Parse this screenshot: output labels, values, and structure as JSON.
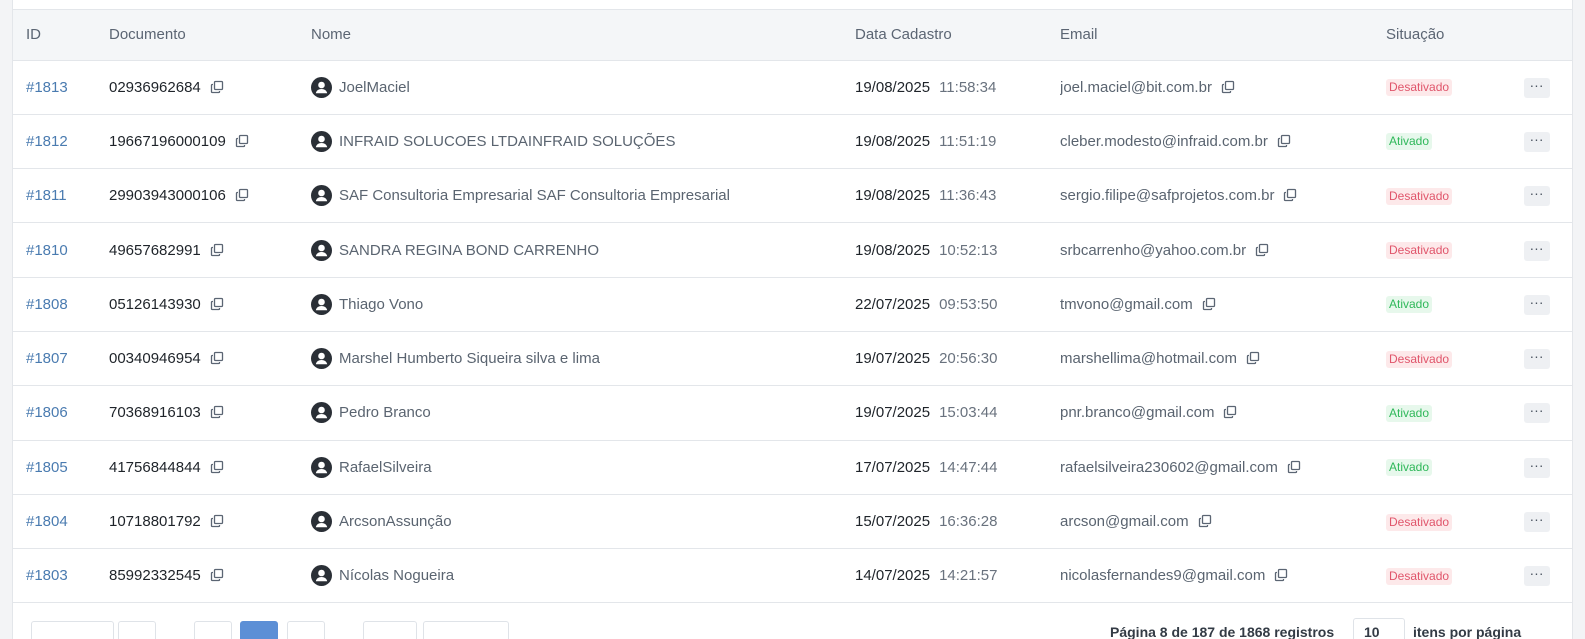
{
  "table": {
    "headers": {
      "id": "ID",
      "documento": "Documento",
      "nome": "Nome",
      "data_cadastro": "Data Cadastro",
      "email": "Email",
      "situacao": "Situação"
    },
    "rows": [
      {
        "id": "#1813",
        "documento": "02936962684",
        "nome": "JoelMaciel",
        "data": "19/08/2025",
        "hora": "11:58:34",
        "email": "joel.maciel@bit.com.br",
        "situacao": "Desativado",
        "status": "off"
      },
      {
        "id": "#1812",
        "documento": "19667196000109",
        "nome": "INFRAID SOLUCOES LTDAINFRAID SOLUÇÕES",
        "data": "19/08/2025",
        "hora": "11:51:19",
        "email": "cleber.modesto@infraid.com.br",
        "situacao": "Ativado",
        "status": "on"
      },
      {
        "id": "#1811",
        "documento": "29903943000106",
        "nome": "SAF Consultoria Empresarial SAF Consultoria Empresarial",
        "data": "19/08/2025",
        "hora": "11:36:43",
        "email": "sergio.filipe@safprojetos.com.br",
        "situacao": "Desativado",
        "status": "off"
      },
      {
        "id": "#1810",
        "documento": "49657682991",
        "nome": "SANDRA REGINA BOND CARRENHO",
        "data": "19/08/2025",
        "hora": "10:52:13",
        "email": "srbcarrenho@yahoo.com.br",
        "situacao": "Desativado",
        "status": "off"
      },
      {
        "id": "#1808",
        "documento": "05126143930",
        "nome": "Thiago Vono",
        "data": "22/07/2025",
        "hora": "09:53:50",
        "email": "tmvono@gmail.com",
        "situacao": "Ativado",
        "status": "on"
      },
      {
        "id": "#1807",
        "documento": "00340946954",
        "nome": "Marshel Humberto Siqueira silva e lima",
        "data": "19/07/2025",
        "hora": "20:56:30",
        "email": "marshellima@hotmail.com",
        "situacao": "Desativado",
        "status": "off"
      },
      {
        "id": "#1806",
        "documento": "70368916103",
        "nome": "Pedro Branco",
        "data": "19/07/2025",
        "hora": "15:03:44",
        "email": "pnr.branco@gmail.com",
        "situacao": "Ativado",
        "status": "on"
      },
      {
        "id": "#1805",
        "documento": "41756844844",
        "nome": "RafaelSilveira",
        "data": "17/07/2025",
        "hora": "14:47:44",
        "email": "rafaelsilveira230602@gmail.com",
        "situacao": "Ativado",
        "status": "on"
      },
      {
        "id": "#1804",
        "documento": "10718801792",
        "nome": "ArcsonAssunção",
        "data": "15/07/2025",
        "hora": "16:36:28",
        "email": "arcson@gmail.com",
        "situacao": "Desativado",
        "status": "off"
      },
      {
        "id": "#1803",
        "documento": "85992332545",
        "nome": "Nícolas Nogueira",
        "data": "14/07/2025",
        "hora": "14:21:57",
        "email": "nicolasfernandes9@gmail.com",
        "situacao": "Desativado",
        "status": "off"
      }
    ],
    "action_label": "···"
  },
  "footer": {
    "info": "Página 8 de 187 de 1868 registros",
    "per_page_value": "10",
    "per_page_suffix": "itens por página"
  },
  "colors": {
    "link": "#4a7bb0",
    "active_page": "#5c8fd6",
    "badge_off_text": "#e0556b",
    "badge_on_text": "#2fb85a"
  },
  "icons": {
    "copy": "copy-icon",
    "avatar": "user-avatar-icon",
    "more": "more-icon"
  }
}
